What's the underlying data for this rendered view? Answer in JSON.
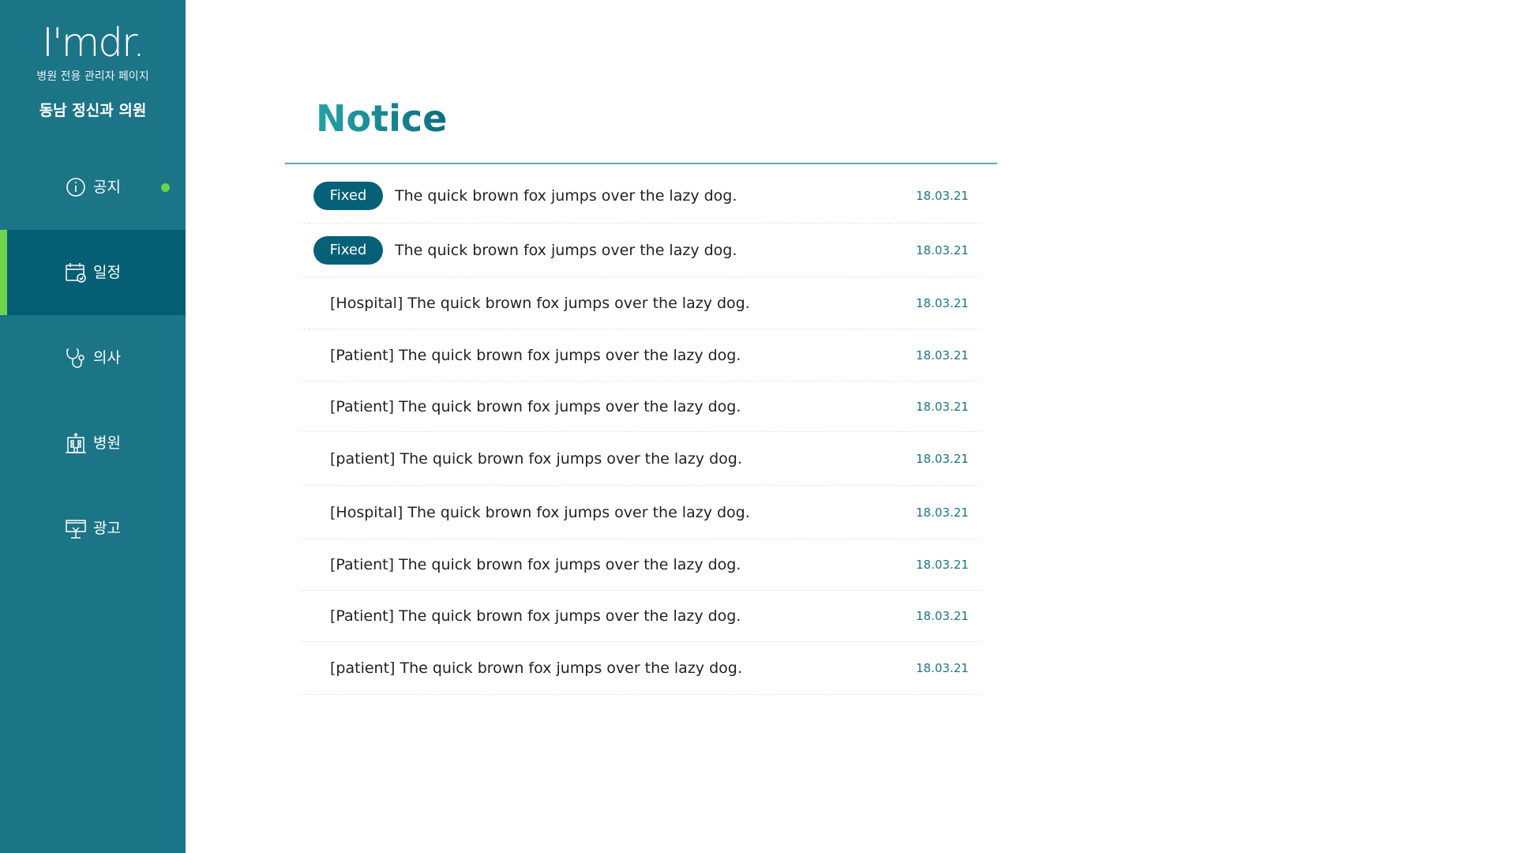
{
  "sidebar": {
    "logo": "I'mdr.",
    "subtitle": "병원 전용 관리자 페이지",
    "clinic_name": "동남 정신과 의원",
    "items": [
      {
        "label": "공지",
        "icon": "info-icon",
        "active": false,
        "has_dot": true
      },
      {
        "label": "일정",
        "icon": "calendar-icon",
        "active": true,
        "has_dot": false
      },
      {
        "label": "의사",
        "icon": "stethoscope-icon",
        "active": false,
        "has_dot": false
      },
      {
        "label": "병원",
        "icon": "hospital-icon",
        "active": false,
        "has_dot": false
      },
      {
        "label": "광고",
        "icon": "billboard-icon",
        "active": false,
        "has_dot": false
      }
    ],
    "colors": {
      "background": "#1c7487",
      "active_background": "#055e74",
      "active_indicator": "#70d44c",
      "dot": "#6ad44a"
    }
  },
  "main": {
    "title": "Notice",
    "notices": [
      {
        "badge": "Fixed",
        "title": "The quick brown fox jumps over the lazy dog.",
        "date": "18.03.21"
      },
      {
        "badge": "Fixed",
        "title": "The quick brown fox jumps over the lazy dog.",
        "date": "18.03.21"
      },
      {
        "badge": "",
        "title": "[Hospital] The quick brown fox jumps over the lazy dog.",
        "date": "18.03.21"
      },
      {
        "badge": "",
        "title": "[Patient] The quick brown fox jumps over the lazy dog.",
        "date": "18.03.21"
      },
      {
        "badge": "",
        "title": "[Patient] The quick brown fox jumps over the lazy dog.",
        "date": "18.03.21"
      },
      {
        "badge": "",
        "title": "[patient] The quick brown fox jumps over the lazy dog.",
        "date": "18.03.21"
      },
      {
        "badge": "",
        "title": "[Hospital] The quick brown fox jumps over the lazy dog.",
        "date": "18.03.21"
      },
      {
        "badge": "",
        "title": "[Patient] The quick brown fox jumps over the lazy dog.",
        "date": "18.03.21"
      },
      {
        "badge": "",
        "title": "[Patient] The quick brown fox jumps over the lazy dog.",
        "date": "18.03.21"
      },
      {
        "badge": "",
        "title": "[patient] The quick brown fox jumps over the lazy dog.",
        "date": "18.03.21"
      }
    ],
    "colors": {
      "title_gradient_start": "#23a3a6",
      "title_gradient_end": "#0f6d82",
      "badge": "#066078",
      "date": "#1c7487"
    }
  }
}
